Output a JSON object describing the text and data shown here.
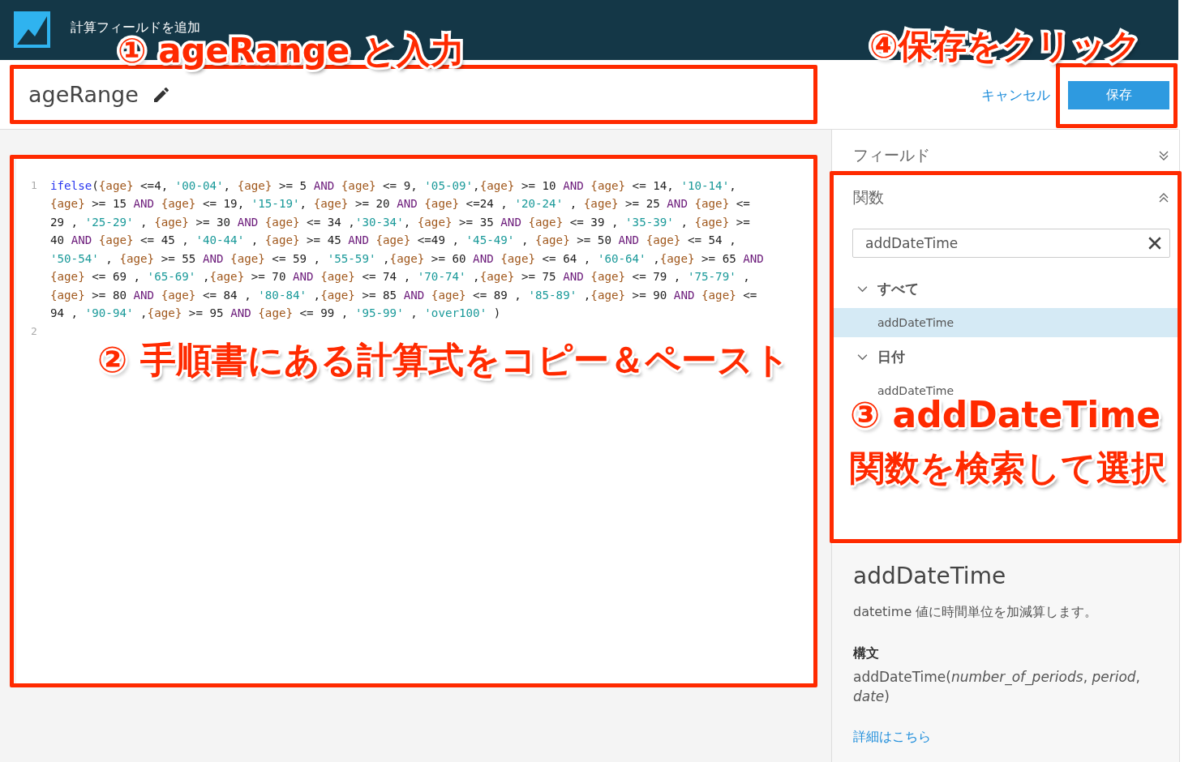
{
  "header": {
    "title": "計算フィールドを追加"
  },
  "field_name": {
    "value": "ageRange"
  },
  "actions": {
    "cancel": "キャンセル",
    "save": "保存"
  },
  "editor": {
    "lines": [
      {
        "number": "1",
        "wrapped": [
          "ifelse({age} <=4, '00-04', {age} >= 5 AND {age} <= 9, '05-09',{age} >= 10 AND {age} <= 14, '10-14',",
          "{age} >= 15 AND {age} <= 19, '15-19', {age} >= 20 AND {age} <=24 , '20-24' , {age} >= 25 AND {age} <=",
          "29 , '25-29' , {age} >= 30 AND {age} <= 34 ,'30-34', {age} >= 35 AND {age} <= 39 , '35-39' , {age} >=",
          "40 AND {age} <= 45 , '40-44' , {age} >= 45 AND {age} <=49 , '45-49' , {age} >= 50 AND {age} <= 54 ,",
          "'50-54' , {age} >= 55 AND {age} <= 59 , '55-59' ,{age} >= 60 AND {age} <= 64 , '60-64' ,{age} >= 65 AND",
          "{age} <= 69 , '65-69' ,{age} >= 70 AND {age} <= 74 , '70-74' ,{age} >= 75 AND {age} <= 79 , '75-79' ,",
          "{age} >= 80 AND {age} <= 84 , '80-84' ,{age} >= 85 AND {age} <= 89 , '85-89' ,{age} >= 90 AND {age} <=",
          "94 , '90-94' ,{age} >= 95 AND {age} <= 99 , '95-99' , 'over100' )"
        ]
      },
      {
        "number": "2"
      }
    ]
  },
  "panel": {
    "sections": [
      {
        "title": "フィールド",
        "expanded": false
      },
      {
        "title": "関数",
        "expanded": true
      }
    ],
    "search": {
      "value": "addDateTime"
    },
    "groups": [
      {
        "label": "すべて",
        "expanded": true,
        "items": [
          {
            "label": "addDateTime",
            "selected": true
          }
        ]
      },
      {
        "label": "日付",
        "expanded": true,
        "items": [
          {
            "label": "addDateTime",
            "selected": false
          }
        ]
      }
    ],
    "description": {
      "title": "addDateTime",
      "summary": "datetime 値に時間単位を加減算します。",
      "syntax_label": "構文",
      "syntax": "addDateTime(*number_of_periods*, *period*, *date*)",
      "link": "詳細はこちら"
    }
  },
  "callouts": [
    "① ageRange と入力",
    "④保存をクリック",
    "② 手順書にある計算式をコピー＆ペースト",
    "③ addDateTime",
    "関数を検索して選択"
  ]
}
